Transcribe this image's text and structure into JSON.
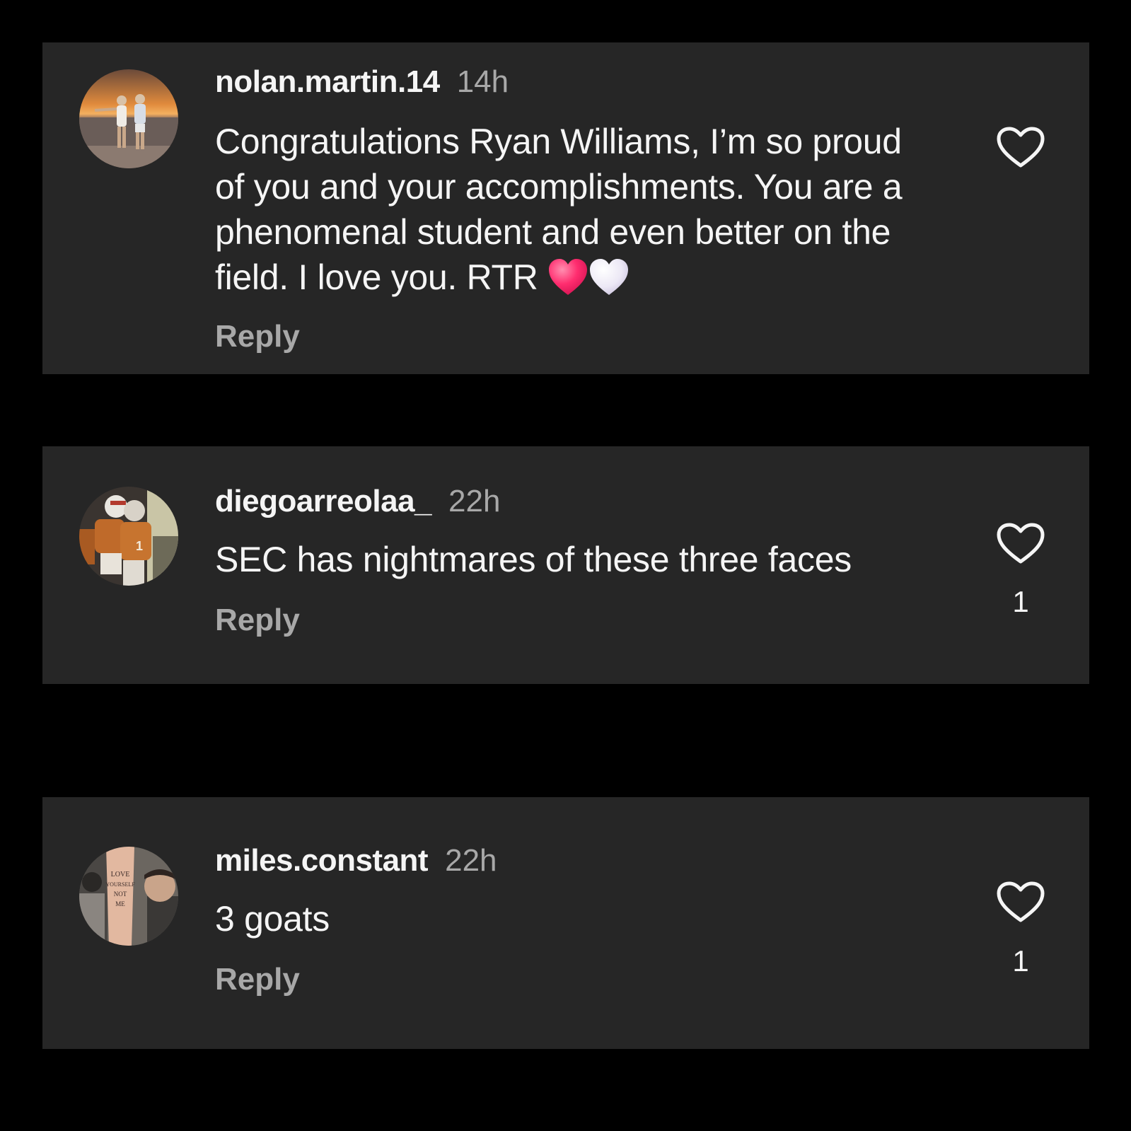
{
  "comments": [
    {
      "username": "nolan.martin.14",
      "time": "14h",
      "text": "Congratulations Ryan Williams, I’m so proud of you and your accomplishments. You are a phenomenal student and even better on the field. I love you. RTR",
      "emojis": [
        "red-heart-emoji",
        "white-heart-emoji"
      ],
      "reply_label": "Reply",
      "like_icon": "heart-outline-icon",
      "like_count": ""
    },
    {
      "username": "diegoarreolaa_",
      "time": "22h",
      "text": "SEC has nightmares of these three faces",
      "reply_label": "Reply",
      "like_icon": "heart-outline-icon",
      "like_count": "1"
    },
    {
      "username": "miles.constant",
      "time": "22h",
      "text": "3 goats",
      "reply_label": "Reply",
      "like_icon": "heart-outline-icon",
      "like_count": "1"
    }
  ],
  "avatar_photos": [
    {
      "image_text": ""
    },
    {
      "image_text": ""
    },
    {
      "image_text": "LOVE YOURSELF NOT ME"
    }
  ],
  "colors": {
    "page_background": "#000000",
    "card_background": "#262626",
    "primary_text": "#f5f5f5",
    "secondary_text": "#a8a8a8",
    "red_heart": "#ff2d6f",
    "white_heart": "#ece8f5"
  }
}
